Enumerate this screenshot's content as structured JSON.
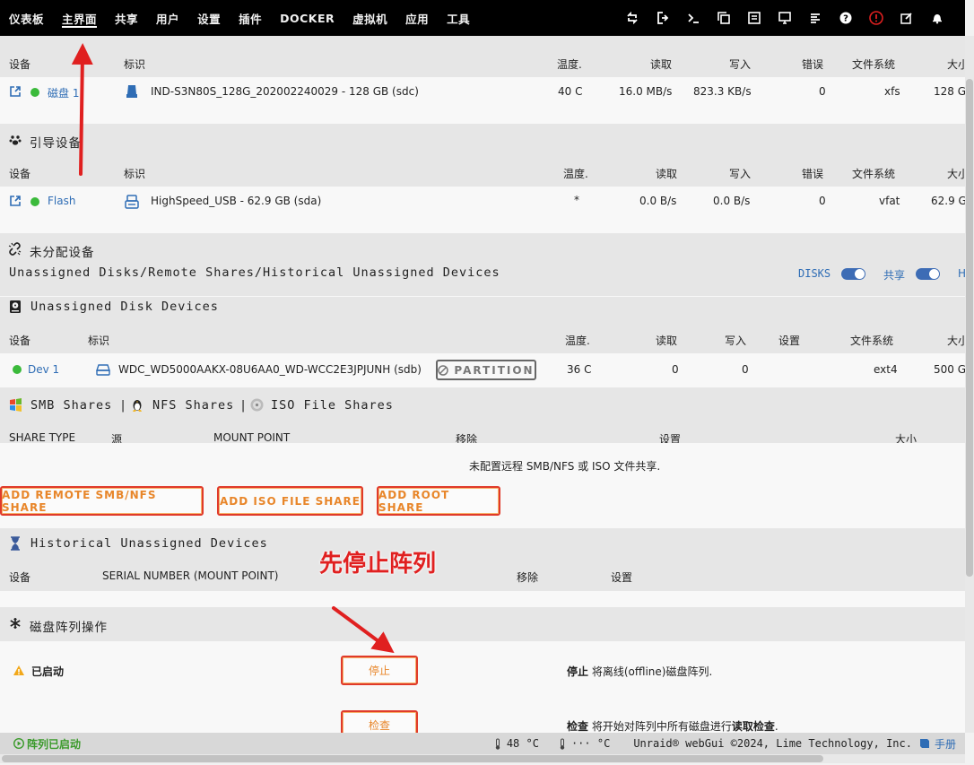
{
  "nav": {
    "items": [
      "仪表板",
      "主界面",
      "共享",
      "用户",
      "设置",
      "插件",
      "DOCKER",
      "虚拟机",
      "应用",
      "工具"
    ],
    "active": 1,
    "icons": [
      "refresh-icon",
      "logout-icon",
      "terminal-icon",
      "copy-window-icon",
      "feedback-icon",
      "monitor-icon",
      "log-icon",
      "help-icon",
      "alert-icon",
      "edit-icon",
      "bell-icon"
    ]
  },
  "array": {
    "headers": [
      "设备",
      "标识",
      "温度.",
      "读取",
      "写入",
      "错误",
      "文件系统",
      "大小"
    ],
    "row": {
      "device": "磁盘 1",
      "id": "IND-S3N80S_128G_202002240029 - 128 GB (sdc)",
      "temp": "40 C",
      "read": "16.0 MB/s",
      "write": "823.3 KB/s",
      "errors": "0",
      "fs": "xfs",
      "size": "128 G"
    }
  },
  "boot": {
    "title": "引导设备",
    "headers": [
      "设备",
      "标识",
      "温度.",
      "读取",
      "写入",
      "错误",
      "文件系统",
      "大小"
    ],
    "row": {
      "device": "Flash",
      "id": "HighSpeed_USB - 62.9 GB (sda)",
      "temp": "*",
      "read": "0.0 B/s",
      "write": "0.0 B/s",
      "errors": "0",
      "fs": "vfat",
      "size": "62.9 G"
    }
  },
  "unassigned": {
    "title": "未分配设备",
    "subtitle": "Unassigned Disks/Remote Shares/Historical Unassigned Devices",
    "toggle_disks": "DISKS",
    "toggle_shares": "共享",
    "toggle_h": "H"
  },
  "ud_disks": {
    "title": "Unassigned Disk Devices",
    "headers": [
      "设备",
      "标识",
      "温度.",
      "读取",
      "写入",
      "设置",
      "文件系统",
      "大小"
    ],
    "row": {
      "device": "Dev 1",
      "id": "WDC_WD5000AAKX-08U6AA0_WD-WCC2E3JPJUNH (sdb)",
      "partition": "PARTITION",
      "temp": "36 C",
      "read": "0",
      "write": "0",
      "fs": "ext4",
      "size": "500 G"
    }
  },
  "shares": {
    "title_smb": "SMB Shares",
    "title_nfs": "NFS Shares",
    "title_iso": "ISO File Shares",
    "sep": "|",
    "headers": [
      "SHARE TYPE",
      "源",
      "MOUNT POINT",
      "移除",
      "设置",
      "大小"
    ],
    "empty": "未配置远程 SMB/NFS 或 ISO 文件共享.",
    "btn_smb": "ADD REMOTE SMB/NFS SHARE",
    "btn_iso": "ADD ISO FILE SHARE",
    "btn_root": "ADD ROOT SHARE"
  },
  "historical": {
    "title": "Historical Unassigned Devices",
    "headers": [
      "设备",
      "SERIAL NUMBER (MOUNT POINT)",
      "移除",
      "设置"
    ]
  },
  "annotation": {
    "text": "先停止阵列",
    "color": "#e02020"
  },
  "array_ops": {
    "title": "磁盘阵列操作",
    "status": "已启动",
    "stop_btn": "停止",
    "stop_desc_bold": "停止",
    "stop_desc": " 将离线(offline)磁盘阵列.",
    "check_btn": "检查",
    "check_desc_bold": "检查",
    "check_desc_mid": " 将开始对阵列中所有磁盘进行",
    "check_desc_bold2": "读取检查",
    "check_desc_end": "."
  },
  "footer": {
    "status": "阵列已启动",
    "temp1": "48 °C",
    "temp2": "··· °C",
    "copyright": "Unraid® webGui ©2024, Lime Technology, Inc.",
    "manual": "手册"
  },
  "colors": {
    "accent_orange": "#e8862a",
    "link_blue": "#2f6db5",
    "status_green": "#3bba3b",
    "arrow_red": "#e02020"
  }
}
